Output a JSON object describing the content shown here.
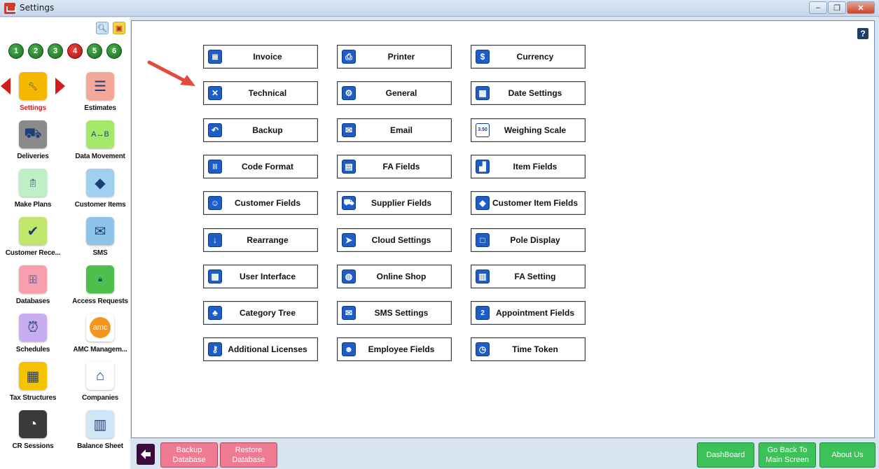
{
  "window": {
    "title": "Settings",
    "controls": [
      "minimize",
      "restore",
      "close"
    ]
  },
  "sidebar": {
    "tools": [
      "search-icon",
      "windows-icon"
    ],
    "steps": [
      "1",
      "2",
      "3",
      "4",
      "5",
      "6"
    ],
    "active_step": "4",
    "items": [
      {
        "label": "Settings",
        "icon": "tools-icon",
        "selected": true
      },
      {
        "label": "Estimates",
        "icon": "estimate-icon"
      },
      {
        "label": "Deliveries",
        "icon": "truck-icon"
      },
      {
        "label": "Data Movement",
        "icon": "data-move-icon"
      },
      {
        "label": "Make Plans",
        "icon": "clipboard-icon"
      },
      {
        "label": "Customer Items",
        "icon": "shapes-icon"
      },
      {
        "label": "Customer Rece...",
        "icon": "checklist-icon"
      },
      {
        "label": "SMS",
        "icon": "sms-icon"
      },
      {
        "label": "Databases",
        "icon": "database-icon"
      },
      {
        "label": "Access Requests",
        "icon": "access-icon"
      },
      {
        "label": "Schedules",
        "icon": "clock-icon"
      },
      {
        "label": "AMC Managem...",
        "icon": "amc-icon",
        "icon_text": "amc"
      },
      {
        "label": "Tax Structures",
        "icon": "tax-icon"
      },
      {
        "label": "Companies",
        "icon": "home-icon"
      },
      {
        "label": "CR Sessions",
        "icon": "cr-session-icon"
      },
      {
        "label": "Balance Sheet",
        "icon": "balance-chart-icon"
      }
    ]
  },
  "main": {
    "help": "?",
    "settings": [
      {
        "label": "Invoice",
        "icon": "invoice-icon"
      },
      {
        "label": "Printer",
        "icon": "printer-icon"
      },
      {
        "label": "Currency",
        "icon": "currency-icon",
        "glyph": "$"
      },
      {
        "label": "Technical",
        "icon": "technical-icon"
      },
      {
        "label": "General",
        "icon": "gear-icon"
      },
      {
        "label": "Date Settings",
        "icon": "calendar-icon"
      },
      {
        "label": "Backup",
        "icon": "backup-icon"
      },
      {
        "label": "Email",
        "icon": "email-icon"
      },
      {
        "label": "Weighing Scale",
        "icon": "scale-icon",
        "glyph": "3.50"
      },
      {
        "label": "Code Format",
        "icon": "barcode-icon"
      },
      {
        "label": "FA Fields",
        "icon": "fa-fields-icon"
      },
      {
        "label": "Item Fields",
        "icon": "item-fields-icon"
      },
      {
        "label": "Customer Fields",
        "icon": "customer-fields-icon"
      },
      {
        "label": "Supplier Fields",
        "icon": "supplier-truck-icon"
      },
      {
        "label": "Customer Item Fields",
        "icon": "customer-item-icon"
      },
      {
        "label": "Rearrange",
        "icon": "rearrange-icon"
      },
      {
        "label": "Cloud Settings",
        "icon": "cloud-icon"
      },
      {
        "label": "Pole Display",
        "icon": "pole-display-icon"
      },
      {
        "label": "User Interface",
        "icon": "ui-grid-icon"
      },
      {
        "label": "Online Shop",
        "icon": "globe-icon"
      },
      {
        "label": "FA Setting",
        "icon": "fa-setting-icon"
      },
      {
        "label": "Category Tree",
        "icon": "tree-icon"
      },
      {
        "label": "SMS Settings",
        "icon": "sms-settings-icon"
      },
      {
        "label": "Appointment Fields",
        "icon": "appointment-icon",
        "glyph": "2"
      },
      {
        "label": "Additional Licenses",
        "icon": "key-icon"
      },
      {
        "label": "Employee Fields",
        "icon": "employee-icon"
      },
      {
        "label": "Time Token",
        "icon": "time-token-icon"
      }
    ]
  },
  "footer": {
    "back": "back-arrow-icon",
    "backup_label": "Backup\nDatabase",
    "restore_label": "Restore\nDatabase",
    "dashboard_label": "DashBoard",
    "main_screen_label": "Go Back To\nMain Screen",
    "about_label": "About Us"
  },
  "colors": {
    "accent_blue": "#1e5cc8",
    "active_red": "#d61f1f",
    "green": "#3dc25a",
    "pink": "#ee7b91"
  }
}
